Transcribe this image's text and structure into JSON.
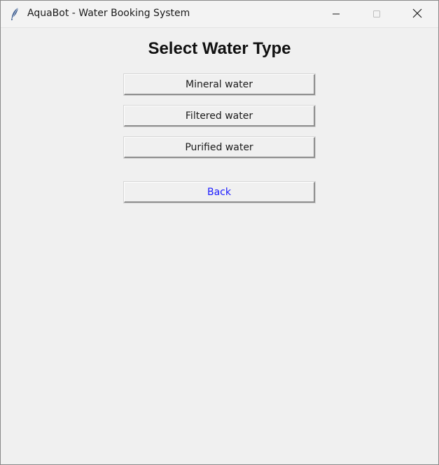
{
  "window": {
    "title": "AquaBot - Water Booking System",
    "icon": "feather-icon"
  },
  "screen": {
    "heading": "Select Water Type"
  },
  "options": [
    {
      "label": "Mineral water"
    },
    {
      "label": "Filtered water"
    },
    {
      "label": "Purified water"
    }
  ],
  "back": {
    "label": "Back",
    "color": "#1a1aff"
  }
}
